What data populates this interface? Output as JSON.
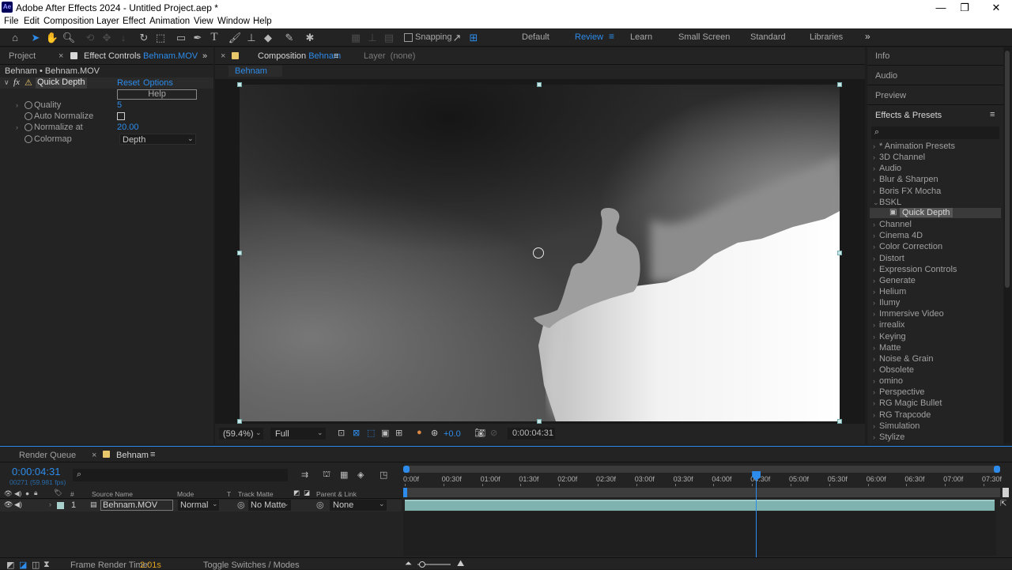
{
  "window": {
    "app_icon": "Ae",
    "title": "Adobe After Effects 2024 - Untitled Project.aep *"
  },
  "menu": [
    "File",
    "Edit",
    "Composition",
    "Layer",
    "Effect",
    "Animation",
    "View",
    "Window",
    "Help"
  ],
  "toolbar": {
    "snapping_label": "Snapping"
  },
  "workspaces": [
    "Default",
    "Review",
    "Learn",
    "Small Screen",
    "Standard",
    "Libraries"
  ],
  "active_workspace": "Review",
  "left_panel": {
    "tab_project": "Project",
    "tab_effect_controls": "Effect Controls",
    "tab_effect_controls_target": "Behnam.MOV",
    "breadcrumb": "Behnam • Behnam.MOV",
    "effect": {
      "fx_label": "fx",
      "name": "Quick Depth",
      "reset": "Reset",
      "options": "Options",
      "help": "Help",
      "props": [
        {
          "label": "Quality",
          "value": "5"
        },
        {
          "label": "Auto Normalize",
          "value": ""
        },
        {
          "label": "Normalize at",
          "value": "20.00"
        },
        {
          "label": "Colormap",
          "value": "Depth"
        }
      ]
    }
  },
  "comp_panel": {
    "tab_label": "Composition",
    "tab_target": "Behnam",
    "layer_tab": "Layer",
    "layer_value": "(none)",
    "comp_chip": "Behnam",
    "zoom": "(59.4%)",
    "resolution": "Full",
    "exposure": "+0.0",
    "timecode": "0:00:04:31"
  },
  "right_panel": {
    "info": "Info",
    "audio": "Audio",
    "preview": "Preview",
    "effects_presets": "Effects & Presets",
    "search_placeholder": "",
    "categories": [
      "* Animation Presets",
      "3D Channel",
      "Audio",
      "Blur & Sharpen",
      "Boris FX Mocha",
      "BSKL",
      "Channel",
      "Cinema 4D",
      "Color Correction",
      "Distort",
      "Expression Controls",
      "Generate",
      "Helium",
      "Ilumy",
      "Immersive Video",
      "irrealix",
      "Keying",
      "Matte",
      "Noise & Grain",
      "Obsolete",
      "omino",
      "Perspective",
      "RG Magic Bullet",
      "RG Trapcode",
      "Simulation",
      "Stylize"
    ],
    "expanded_category": "BSKL",
    "selected_effect": "Quick Depth"
  },
  "timeline": {
    "tab_render_queue": "Render Queue",
    "tab_comp": "Behnam",
    "timecode": "0:00:04:31",
    "frame_info": "00271 (59.981 fps)",
    "columns": {
      "source_name": "Source Name",
      "mode": "Mode",
      "t": "T",
      "track_matte": "Track Matte",
      "parent_link": "Parent & Link",
      "num": "#"
    },
    "layer": {
      "index": "1",
      "name": "Behnam.MOV",
      "mode": "Normal",
      "matte": "No Matte",
      "parent": "None"
    },
    "ticks": [
      "0:00f",
      "00:30f",
      "01:00f",
      "01:30f",
      "02:00f",
      "02:30f",
      "03:00f",
      "03:30f",
      "04:00f",
      "04:30f",
      "05:00f",
      "05:30f",
      "06:00f",
      "06:30f",
      "07:00f",
      "07:30f"
    ],
    "playhead_time": "0:00:04:31",
    "playhead_fraction": 0.591
  },
  "status": {
    "frame_render_label": "Frame Render Time:",
    "frame_render_value": "2.01s",
    "toggle_label": "Toggle Switches / Modes"
  },
  "colors": {
    "accent": "#2d8ceb",
    "panel": "#232323",
    "bg": "#1d1d1d",
    "label_yellow": "#e8c66a",
    "clip_teal": "#7fb3b0"
  }
}
